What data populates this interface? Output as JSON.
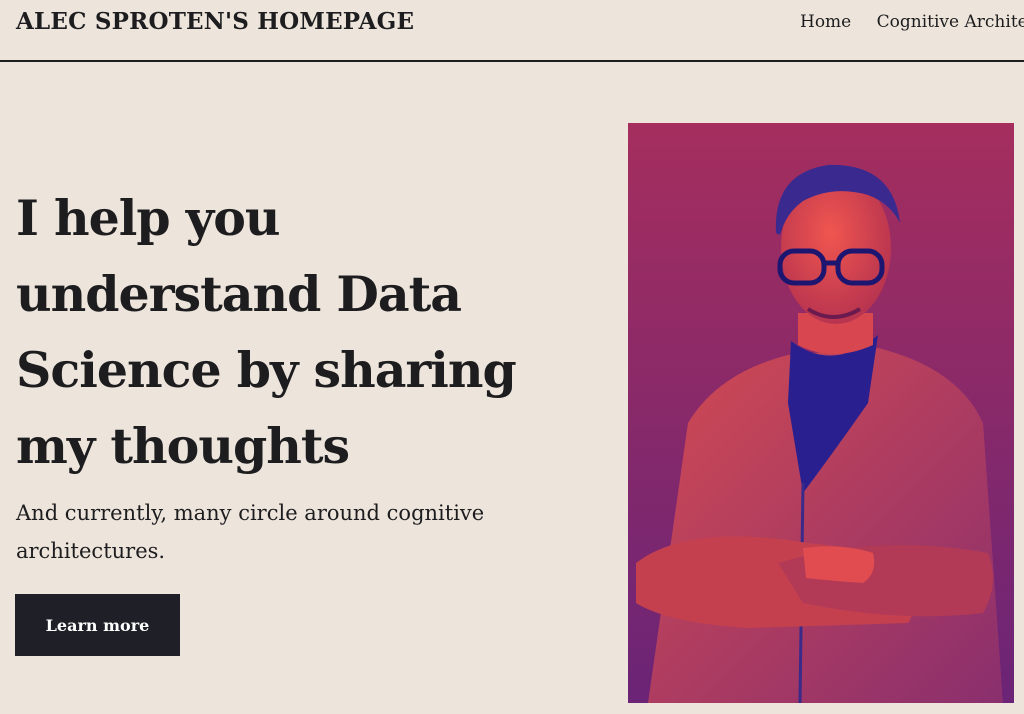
{
  "header": {
    "site_title": "ALEC SPROTEN'S HOMEPAGE",
    "nav": [
      {
        "label": "Home"
      },
      {
        "label": "Cognitive Architectures"
      }
    ]
  },
  "hero": {
    "heading": "I help you understand Data Science by sharing my thoughts",
    "subheading": "And currently, many circle around cognitive architectures.",
    "cta_label": "Learn more"
  },
  "portrait": {
    "description_icon": "person-portrait-photo",
    "colors": {
      "background_top": "#a52e5e",
      "background_bottom": "#6b2476",
      "skin": "#e6504f",
      "shadow": "#2a1f8f",
      "jacket": "#c9434f"
    }
  },
  "colors": {
    "page_background": "#ede5dc",
    "text": "#1d1d1f",
    "button": "#1f2027",
    "button_text": "#ffffff"
  }
}
